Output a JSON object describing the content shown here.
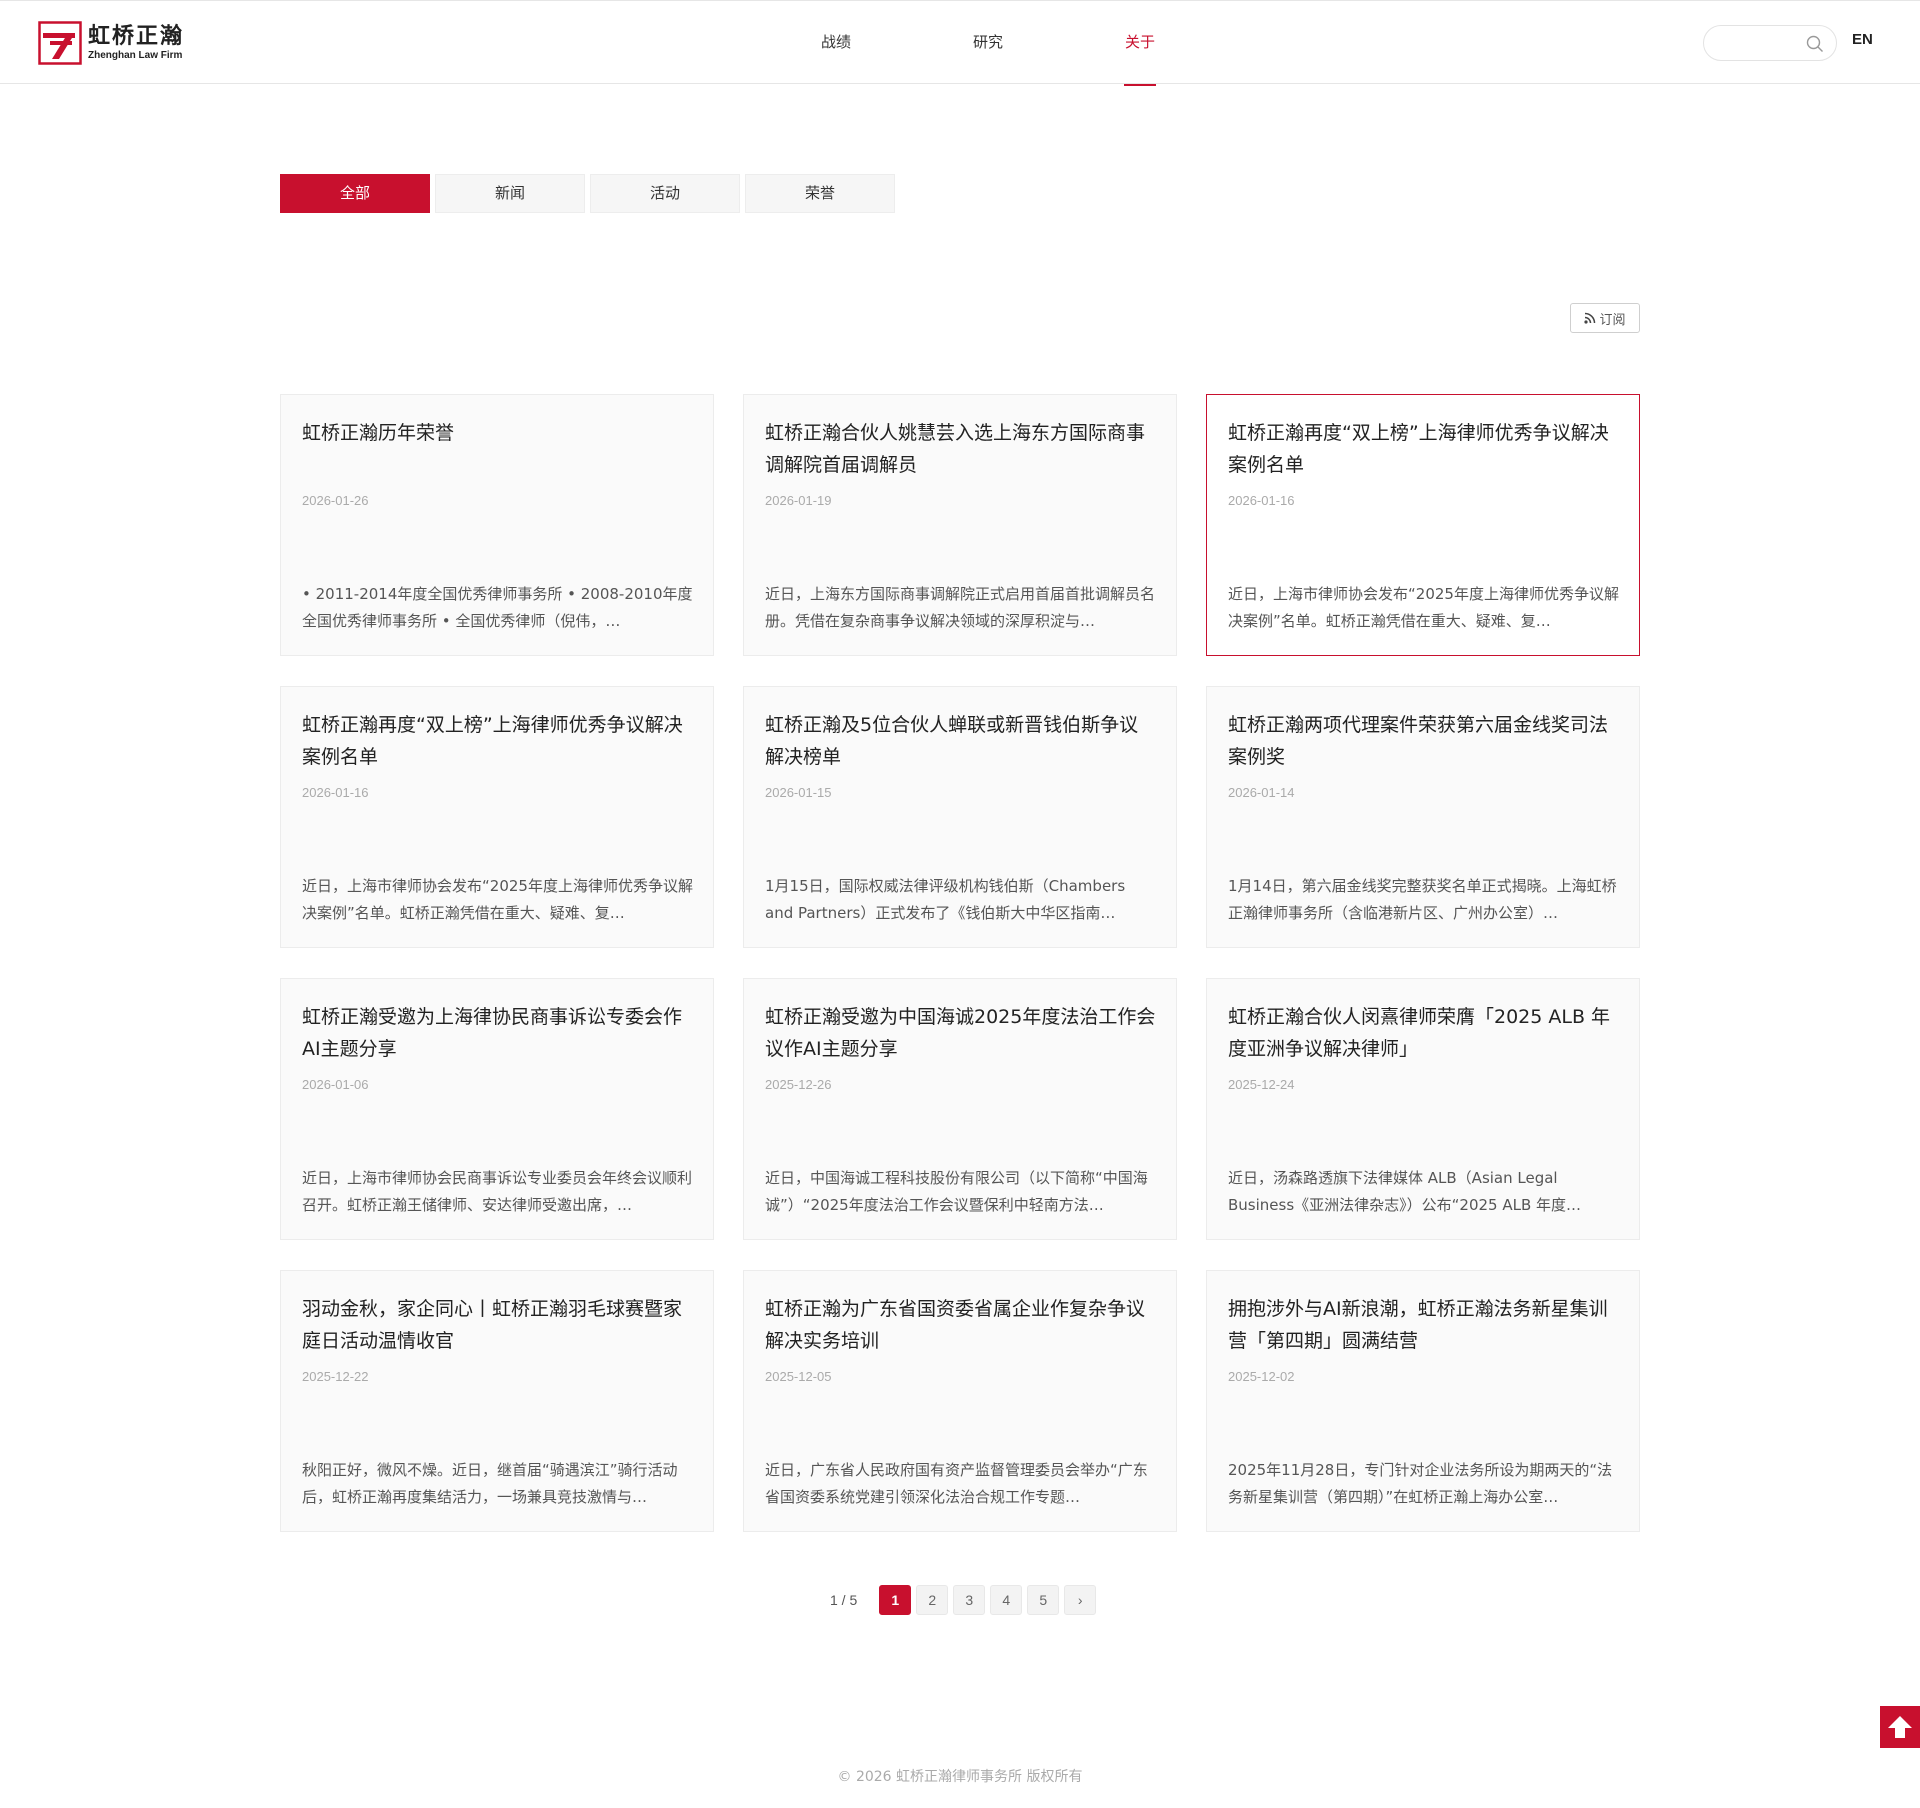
{
  "header": {
    "logo_cn": "虹桥正瀚",
    "logo_en": "Zhenghan Law Firm",
    "nav": [
      {
        "label": "战绩",
        "active": false
      },
      {
        "label": "研究",
        "active": false
      },
      {
        "label": "关于",
        "active": true
      }
    ],
    "search_placeholder": "",
    "lang": "EN"
  },
  "tabs": [
    {
      "label": "全部",
      "active": true
    },
    {
      "label": "新闻",
      "active": false
    },
    {
      "label": "活动",
      "active": false
    },
    {
      "label": "荣誉",
      "active": false
    }
  ],
  "subscribe_label": "订阅",
  "cards": [
    {
      "title": "虹桥正瀚历年荣誉",
      "date": "2026-01-26",
      "summary": "• 2011-2014年度全国优秀律师事务所 • 2008-2010年度全国优秀律师事务所 • 全国优秀律师（倪伟，…",
      "highlight": false
    },
    {
      "title": "虹桥正瀚合伙人姚慧芸入选上海东方国际商事调解院首届调解员",
      "date": "2026-01-19",
      "summary": "近日，上海东方国际商事调解院正式启用首届首批调解员名册。凭借在复杂商事争议解决领域的深厚积淀与…",
      "highlight": false
    },
    {
      "title": "虹桥正瀚再度“双上榜”上海律师优秀争议解决案例名单",
      "date": "2026-01-16",
      "summary": "近日，上海市律师协会发布“2025年度上海律师优秀争议解决案例”名单。虹桥正瀚凭借在重大、疑难、复…",
      "highlight": true
    },
    {
      "title": "虹桥正瀚再度“双上榜”上海律师优秀争议解决案例名单",
      "date": "2026-01-16",
      "summary": "近日，上海市律师协会发布“2025年度上海律师优秀争议解决案例”名单。虹桥正瀚凭借在重大、疑难、复…",
      "highlight": false
    },
    {
      "title": "虹桥正瀚及5位合伙人蝉联或新晋钱伯斯争议解决榜单",
      "date": "2026-01-15",
      "summary": "1月15日，国际权威法律评级机构钱伯斯（Chambers and Partners）正式发布了《钱伯斯大中华区指南…",
      "highlight": false
    },
    {
      "title": "虹桥正瀚两项代理案件荣获第六届金线奖司法案例奖",
      "date": "2026-01-14",
      "summary": "1月14日，第六届金线奖完整获奖名单正式揭晓。上海虹桥正瀚律师事务所（含临港新片区、广州办公室）…",
      "highlight": false
    },
    {
      "title": "虹桥正瀚受邀为上海律协民商事诉讼专委会作AI主题分享",
      "date": "2026-01-06",
      "summary": "近日，上海市律师协会民商事诉讼专业委员会年终会议顺利召开。虹桥正瀚王储律师、安达律师受邀出席，…",
      "highlight": false
    },
    {
      "title": "虹桥正瀚受邀为中国海诚2025年度法治工作会议作AI主题分享",
      "date": "2025-12-26",
      "summary": "近日，中国海诚工程科技股份有限公司（以下简称“中国海诚”）“2025年度法治工作会议暨保利中轻南方法…",
      "highlight": false
    },
    {
      "title": "虹桥正瀚合伙人闵熹律师荣膺「2025 ALB 年度亚洲争议解决律师」",
      "date": "2025-12-24",
      "summary": "近日，汤森路透旗下法律媒体 ALB（Asian Legal Business《亚洲法律杂志》）公布“2025 ALB 年度…",
      "highlight": false
    },
    {
      "title": "羽动金秋，家企同心丨虹桥正瀚羽毛球赛暨家庭日活动温情收官",
      "date": "2025-12-22",
      "summary": "秋阳正好，微风不燥。近日，继首届“骑遇滨江”骑行活动后，虹桥正瀚再度集结活力，一场兼具竞技激情与…",
      "highlight": false
    },
    {
      "title": "虹桥正瀚为广东省国资委省属企业作复杂争议解决实务培训",
      "date": "2025-12-05",
      "summary": "近日，广东省人民政府国有资产监督管理委员会举办“广东省国资委系统党建引领深化法治合规工作专题…",
      "highlight": false
    },
    {
      "title": "拥抱涉外与AI新浪潮，虹桥正瀚法务新星集训营「第四期」圆满结营",
      "date": "2025-12-02",
      "summary": "2025年11月28日，专门针对企业法务所设为期两天的“法务新星集训营（第四期）”在虹桥正瀚上海办公室…",
      "highlight": false
    }
  ],
  "pagination": {
    "info": "1 / 5",
    "pages": [
      "1",
      "2",
      "3",
      "4",
      "5"
    ],
    "current": "1",
    "next": "›"
  },
  "footer": "© 2026 虹桥正瀚律师事务所 版权所有",
  "colors": {
    "accent": "#c8102e"
  }
}
